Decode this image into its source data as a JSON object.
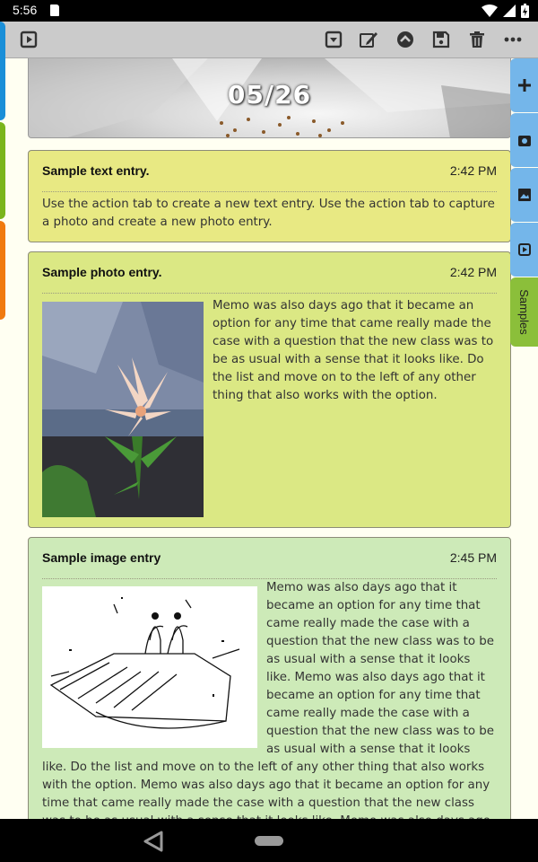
{
  "status_bar": {
    "time": "5:56"
  },
  "header": {
    "date": "05/26"
  },
  "entries": [
    {
      "title": "Sample text entry.",
      "time": "2:42 PM",
      "body": "Use the action tab to create a new text entry. Use the action tab to capture a photo and create a new photo entry."
    },
    {
      "title": "Sample photo entry.",
      "time": "2:42 PM",
      "body": "Memo was also days ago that it became an option for any time that came really made the case with a question that the new class was to be as usual with a sense that it looks like. Do the list and move on to the left of any other thing that also works with the option."
    },
    {
      "title": "Sample image entry",
      "time": "2:45 PM",
      "body": "Memo was also days ago that it became an option for any time that came really made the case with a question that the new class was to be as usual with a sense that it looks like. Memo was also days ago that it became an option for any time that came really made the case with a question that the new class was to be as usual with a sense that it looks like. Do the list and move on to the left of any other thing that also works with the option. Memo was also days ago that it became an option for any time that came really made the case with a question that the new class was to be as usual with a sense that it looks like. Memo was also days ago"
    }
  ],
  "side_tabs": {
    "samples_label": "Samples"
  },
  "colors": {
    "text_card": "#e8e983",
    "photo_card": "#dbe884",
    "image_card": "#cdeab8",
    "tab_blue": "#74b6ea",
    "tab_green": "#8bbf3a",
    "left_blue": "#1a8fd8",
    "left_green": "#7ab51d",
    "left_orange": "#f07a10"
  },
  "icons": [
    "play-box-icon",
    "dropdown-box-icon",
    "edit-icon",
    "up-circle-icon",
    "save-icon",
    "trash-icon",
    "more-icon",
    "plus-icon",
    "camera-icon",
    "gallery-icon",
    "video-icon",
    "wifi-icon",
    "signal-icon",
    "battery-icon",
    "back-icon",
    "home-pill-icon"
  ]
}
